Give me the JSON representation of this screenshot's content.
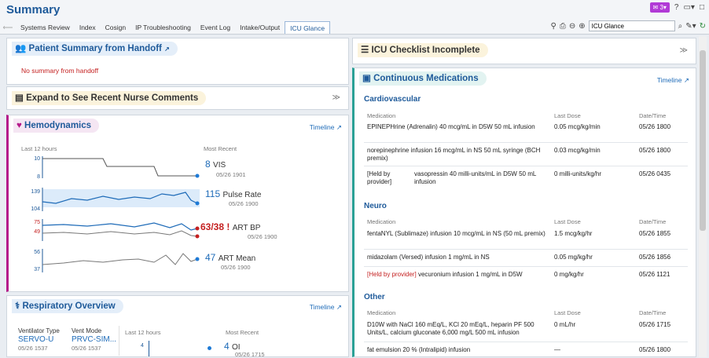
{
  "header": {
    "title": "Summary",
    "tabs": [
      "Systems Review",
      "Index",
      "Cosign",
      "IP Troubleshooting",
      "Event Log",
      "Intake/Output",
      "ICU Glance"
    ],
    "active_tab": "ICU Glance",
    "search_value": "ICU Glance",
    "badge": "3",
    "accent": "#b13ad6"
  },
  "patient_summary": {
    "title": "Patient Summary from Handoff",
    "message": "No summary from handoff"
  },
  "nurse_comments": {
    "title": "Expand to See Recent Nurse Comments"
  },
  "hemodynamics": {
    "title": "Hemodynamics",
    "timeline": "Timeline",
    "range_label": "Last 12 hours",
    "recent_label": "Most Recent",
    "rows": [
      {
        "top": "10",
        "bottom": "8",
        "value": "8",
        "name": "VIS",
        "time": "05/26 1901"
      },
      {
        "top": "139",
        "bottom": "104",
        "value": "115",
        "name": "Pulse Rate",
        "time": "05/26 1900"
      },
      {
        "top": "75",
        "bottom": "49",
        "value": "63/38",
        "flag": "!",
        "name": "ART BP",
        "time": "05/26 1900"
      },
      {
        "top": "56",
        "bottom": "37",
        "value": "47",
        "name": "ART Mean",
        "time": "05/26 1900"
      }
    ]
  },
  "respiratory": {
    "title": "Respiratory Overview",
    "timeline": "Timeline",
    "vent_type_label": "Ventilator Type",
    "vent_type_value": "SERVO-U",
    "vent_type_time": "05/26 1537",
    "vent_mode_label": "Vent Mode",
    "vent_mode_value": "PRVC-SIM...",
    "vent_mode_time": "05/26 1537",
    "range_label": "Last 12 hours",
    "recent_label": "Most Recent",
    "oi_top": "4",
    "oi_value": "4",
    "oi_name": "OI",
    "oi_time": "05/26 1715"
  },
  "checklist": {
    "title": "ICU Checklist Incomplete"
  },
  "medications": {
    "title": "Continuous Medications",
    "timeline": "Timeline",
    "col_med": "Medication",
    "col_dose": "Last Dose",
    "col_date": "Date/Time",
    "groups": [
      {
        "name": "Cardiovascular",
        "rows": [
          {
            "med": "EPINEPHrine (Adrenalin) 40 mcg/mL in D5W 50 mL infusion",
            "dose": "0.05 mcg/kg/min",
            "date": "05/26 1800"
          },
          {
            "med": "norepinephrine infusion 16 mcg/mL in NS 50 mL syringe (BCH premix)",
            "dose": "0.03 mcg/kg/min",
            "date": "05/26 1800"
          },
          {
            "held": "[Held by provider]",
            "med": "vasopressin 40 milli-units/mL in D5W 50 mL infusion",
            "dose": "0 milli-units/kg/hr",
            "date": "05/26 0435"
          }
        ]
      },
      {
        "name": "Neuro",
        "rows": [
          {
            "med": "fentaNYL (Sublimaze) infusion 10 mcg/mL in NS (50 mL premix)",
            "dose": "1.5 mcg/kg/hr",
            "date": "05/26 1855"
          },
          {
            "med": "midazolam (Versed) infusion 1 mg/mL in NS",
            "dose": "0.05 mg/kg/hr",
            "date": "05/26 1856"
          },
          {
            "held": "[Held by provider]",
            "med": "vecuronium infusion 1 mg/mL in D5W",
            "dose": "0 mg/kg/hr",
            "date": "05/26 1121"
          }
        ]
      },
      {
        "name": "Other",
        "rows": [
          {
            "med": "D10W with NaCl 160 mEq/L, KCl 20 mEq/L, heparin PF 500 Units/L, calcium gluconate 6,000 mg/L 500 mL infusion",
            "dose": "0 mL/hr",
            "date": "05/26 1715"
          },
          {
            "med": "fat emulsion 20 % (Intralipid) infusion",
            "dose": "—",
            "date": "05/26 1800"
          }
        ]
      }
    ]
  }
}
